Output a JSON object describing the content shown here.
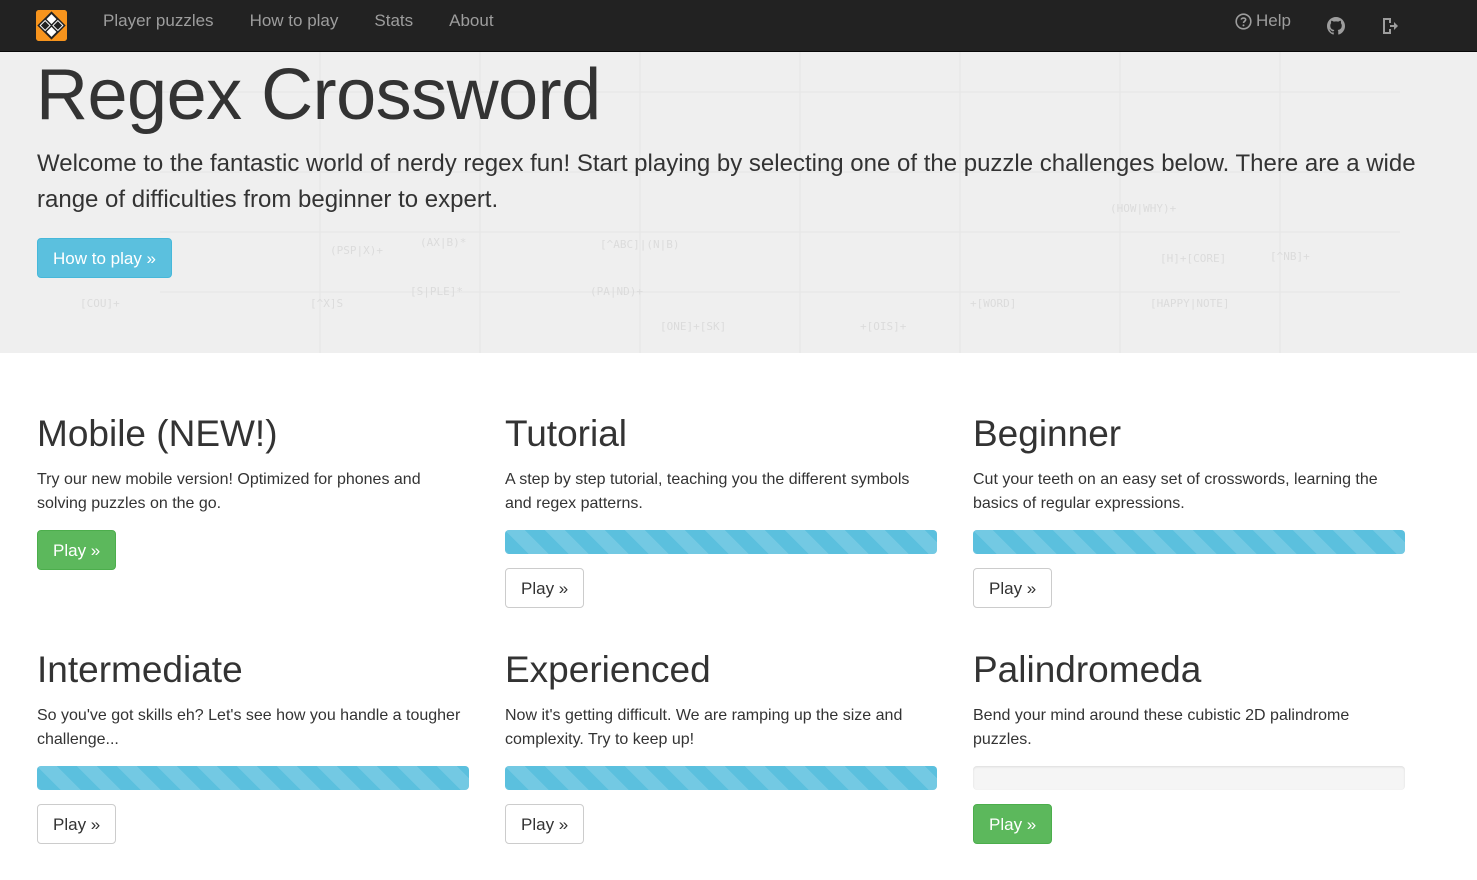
{
  "navbar": {
    "brand_icon": "regex-crossword-logo-icon",
    "brand_color": "#f7941d",
    "links": [
      {
        "label": "Player puzzles"
      },
      {
        "label": "How to play"
      },
      {
        "label": "Stats"
      },
      {
        "label": "About"
      }
    ],
    "help_label": "Help",
    "help_icon": "question-circle-icon",
    "github_icon": "github-icon",
    "logout_icon": "sign-out-icon"
  },
  "hero": {
    "title": "Regex Crossword",
    "text": "Welcome to the fantastic world of nerdy regex fun! Start playing by selecting one of the puzzle challenges below. There are a wide range of difficulties from beginner to expert.",
    "button_label": "How to play »"
  },
  "colors": {
    "info": "#5bc0de",
    "success": "#5cb85c",
    "navbar": "#222222"
  },
  "cards": [
    {
      "title": "Mobile (NEW!)",
      "text": "Try our new mobile version! Optimized for phones and solving puzzles on the go.",
      "progress": null,
      "button_label": "Play »",
      "button_style": "success"
    },
    {
      "title": "Tutorial",
      "text": "A step by step tutorial, teaching you the different symbols and regex patterns.",
      "progress": 1.0,
      "button_label": "Play »",
      "button_style": "default"
    },
    {
      "title": "Beginner",
      "text": "Cut your teeth on an easy set of crosswords, learning the basics of regular expressions.",
      "progress": 1.0,
      "button_label": "Play »",
      "button_style": "default"
    },
    {
      "title": "Intermediate",
      "text": "So you've got skills eh? Let's see how you handle a tougher challenge...",
      "progress": 1.0,
      "button_label": "Play »",
      "button_style": "default"
    },
    {
      "title": "Experienced",
      "text": "Now it's getting difficult. We are ramping up the size and complexity. Try to keep up!",
      "progress": 1.0,
      "button_label": "Play »",
      "button_style": "default"
    },
    {
      "title": "Palindromeda",
      "text": "Bend your mind around these cubistic 2D palindrome puzzles.",
      "progress": 0.0,
      "button_label": "Play »",
      "button_style": "success"
    }
  ]
}
